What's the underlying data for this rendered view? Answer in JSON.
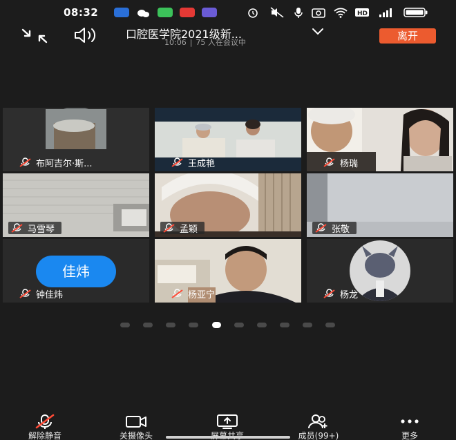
{
  "status_bar": {
    "time": "08:32"
  },
  "header": {
    "meeting_title": "口腔医学院2021级新...",
    "elapsed": "10:06",
    "separator": "|",
    "participants_text": "75 人在会议中",
    "leave_label": "离开"
  },
  "colors": {
    "leave": "#ec5b2f",
    "avatar_blue": "#1a88f0",
    "background": "#1c1c1c"
  },
  "participants": [
    {
      "name": "布阿吉尔·斯...",
      "muted": true
    },
    {
      "name": "王成艳",
      "muted": true
    },
    {
      "name": "杨瑞",
      "muted": true
    },
    {
      "name": "马雪琴",
      "muted": true
    },
    {
      "name": "孟颖",
      "muted": true
    },
    {
      "name": "张敬",
      "muted": true
    },
    {
      "name": "钟佳炜",
      "muted": true,
      "avatar_text": "佳炜"
    },
    {
      "name": "杨亚宁",
      "muted": true
    },
    {
      "name": "杨龙",
      "muted": true
    }
  ],
  "pagination": {
    "total": 10,
    "current": 5
  },
  "toolbar": {
    "unmute": "解除静音",
    "camera_off": "关摄像头",
    "screen_share": "屏幕共享",
    "members": "成员(99+)",
    "more": "更多"
  },
  "icons": [
    "shrink-icon",
    "speaker-icon",
    "chevron-down-icon",
    "mic-muted-icon",
    "camera-icon",
    "screen-share-icon",
    "members-icon",
    "more-icon"
  ]
}
